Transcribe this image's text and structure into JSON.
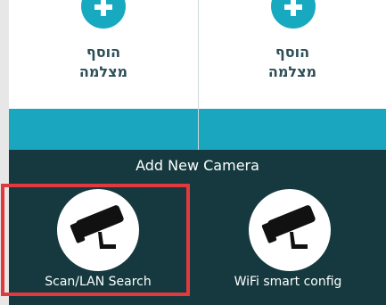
{
  "cards": [
    {
      "label_line1": "הוסף",
      "label_line2": "מצלמה"
    },
    {
      "label_line1": "הוסף",
      "label_line2": "מצלמה"
    }
  ],
  "panel": {
    "title": "Add New Camera",
    "options": [
      {
        "label": "Scan/LAN Search",
        "icon": "security-camera-icon"
      },
      {
        "label": "WiFi smart config",
        "icon": "security-camera-icon"
      }
    ]
  },
  "colors": {
    "accent": "#1aa6bf",
    "panel_bg": "#15393f",
    "card_text": "#2e4f57",
    "highlight": "#e0393e"
  }
}
